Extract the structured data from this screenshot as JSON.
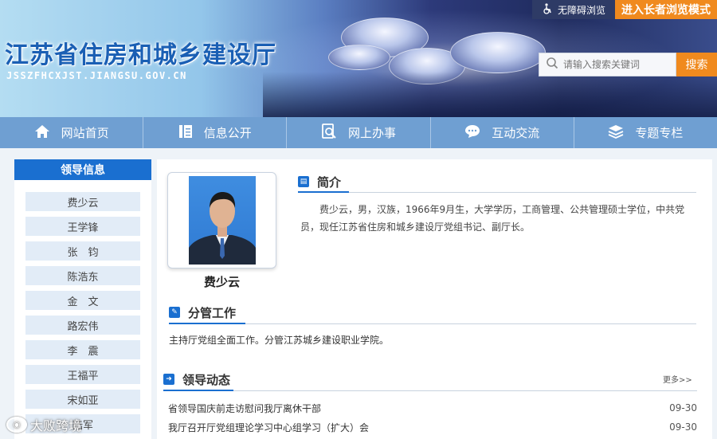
{
  "header": {
    "site_title": "江苏省住房和城乡建设厅",
    "site_url": "JSSZFHCXJST.JIANGSU.GOV.CN",
    "accessibility_label": "无障碍浏览",
    "elder_mode_label": "进入长者浏览模式",
    "search_placeholder": "请输入搜索关键词",
    "search_button": "搜索"
  },
  "nav": {
    "items": [
      {
        "label": "网站首页",
        "icon": "home-icon"
      },
      {
        "label": "信息公开",
        "icon": "document-icon"
      },
      {
        "label": "网上办事",
        "icon": "search-doc-icon"
      },
      {
        "label": "互动交流",
        "icon": "chat-icon"
      },
      {
        "label": "专题专栏",
        "icon": "layers-icon"
      }
    ]
  },
  "sidebar": {
    "title": "领导信息",
    "leaders": [
      "费少云",
      "王学锋",
      "张　钧",
      "陈浩东",
      "金　文",
      "路宏伟",
      "李　震",
      "王福平",
      "宋如亚",
      "陆军"
    ]
  },
  "profile": {
    "name": "费少云",
    "intro_title": "简介",
    "intro_text": "费少云，男，汉族，1966年9月生，大学学历，工商管理、公共管理硕士学位，中共党员，现任江苏省住房和城乡建设厅党组书记、副厅长。",
    "duty_title": "分管工作",
    "duty_text": "主持厅党组全面工作。分管江苏城乡建设职业学院。"
  },
  "news": {
    "title": "领导动态",
    "more_label": "更多>>",
    "items": [
      {
        "title": "省领导国庆前走访慰问我厅离休干部",
        "date": "09-30"
      },
      {
        "title": "我厅召开厅党组理论学习中心组学习（扩大）会",
        "date": "09-30"
      }
    ]
  },
  "watermark": {
    "text": "大败跨境"
  },
  "colors": {
    "accent_blue": "#1a6fd0",
    "nav_blue": "#6f9fd2",
    "orange": "#f08a1e",
    "item_bg": "#e2ecf7"
  }
}
